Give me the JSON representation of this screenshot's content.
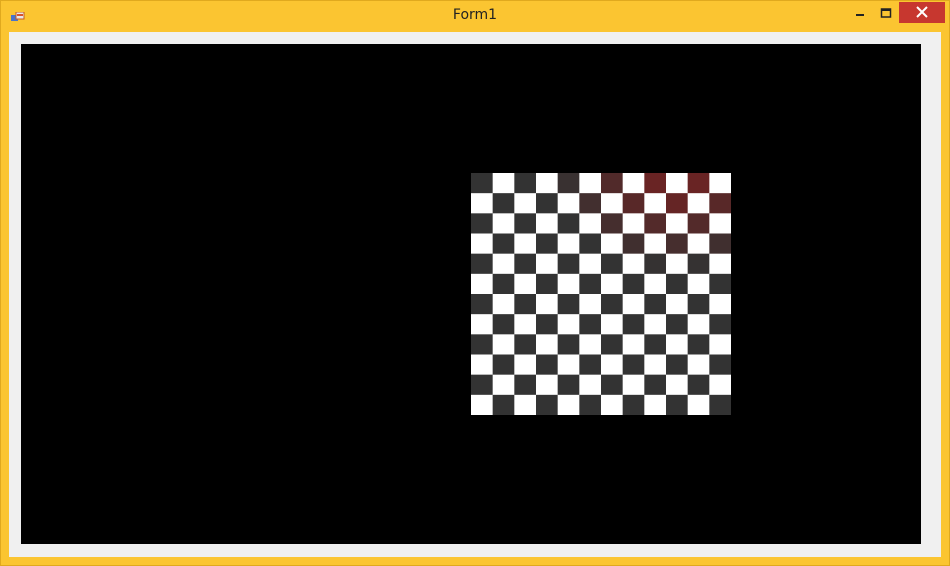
{
  "window": {
    "title": "Form1",
    "frame_color": "#fbc531",
    "close_color": "#c7372f"
  },
  "icons": {
    "app": "form-app-icon",
    "minimize": "minimize-icon",
    "maximize": "maximize-icon",
    "close": "close-icon"
  },
  "canvas": {
    "background": "#000000"
  },
  "checkerboard": {
    "columns": 12,
    "rows": 12,
    "light_color": "#ffffff",
    "dark_color": "#333333",
    "tint_color": "#8b1a1a"
  }
}
